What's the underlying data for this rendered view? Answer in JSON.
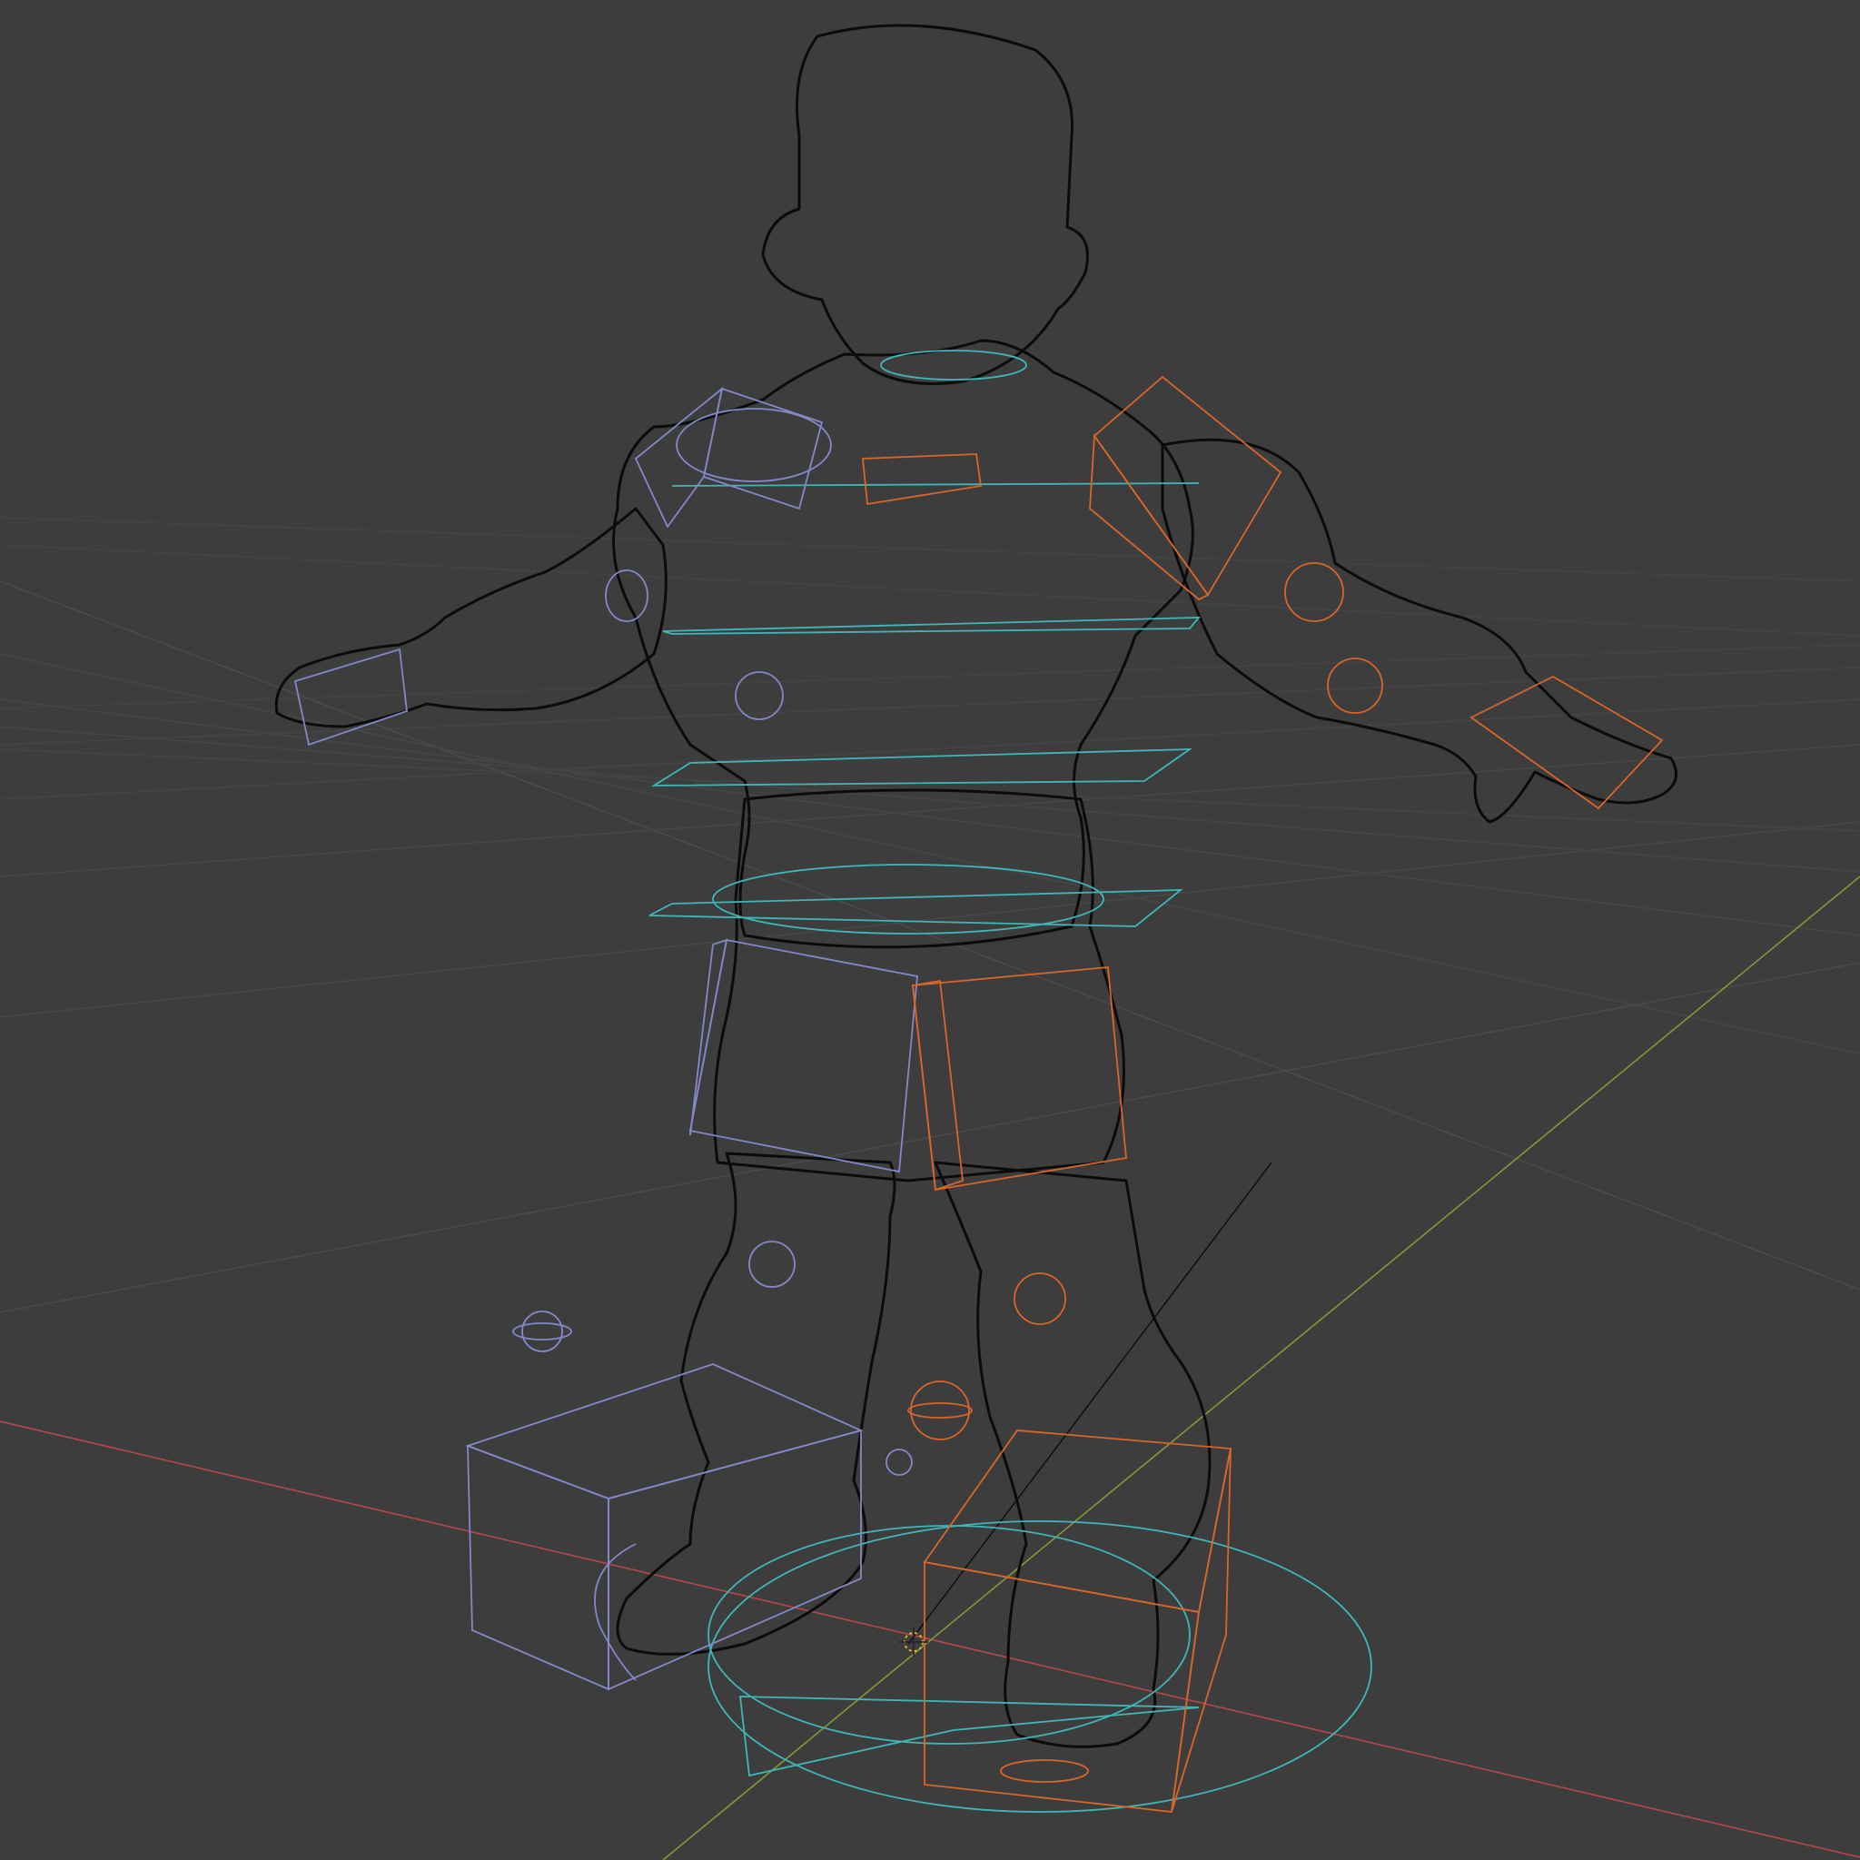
{
  "viewport": {
    "name": "3D Viewport",
    "shading_mode": "wireframe",
    "background_color": "#3d3d3d"
  },
  "grid": {
    "line_color": "#4a4a4a",
    "x_axis_color": "#b5484c",
    "y_axis_color": "#7f9a3a"
  },
  "mesh": {
    "object_type": "character",
    "wire_color": "#0b0b0b",
    "fill_color": "#3a3a3a"
  },
  "rig": {
    "left_side_color": "#8488c8",
    "right_side_color": "#d8662a",
    "center_color": "#3fb7b7"
  },
  "cursor_3d": {
    "color": "#e0b030"
  }
}
